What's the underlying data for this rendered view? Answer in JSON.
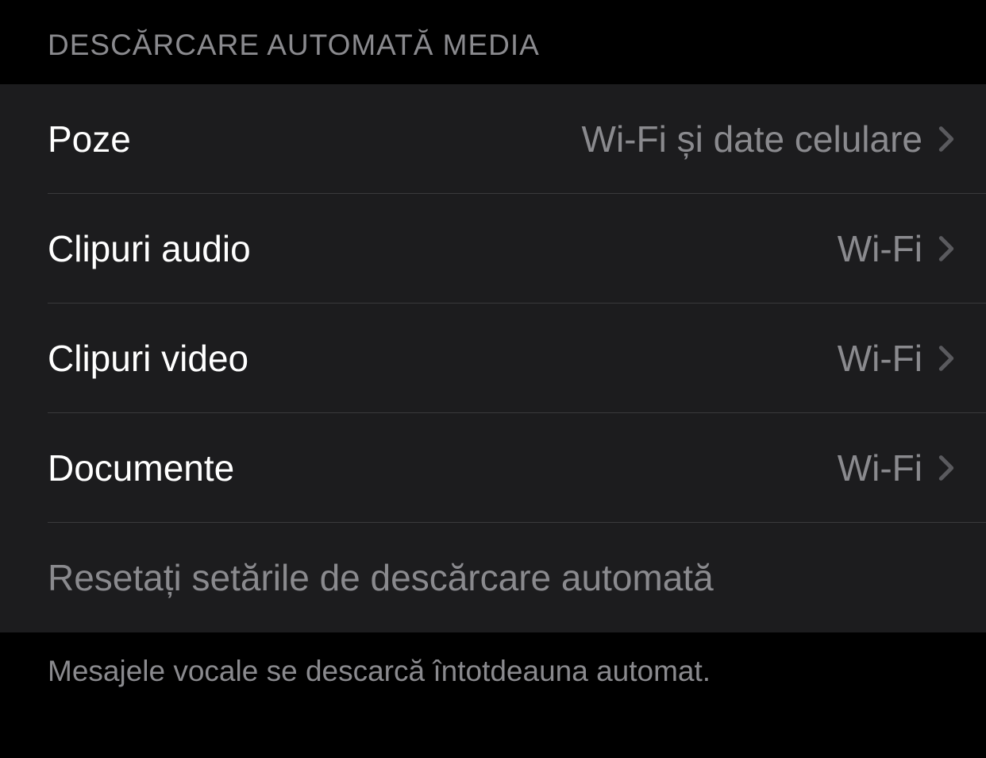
{
  "section": {
    "header": "DESCĂRCARE AUTOMATĂ MEDIA",
    "rows": [
      {
        "label": "Poze",
        "value": "Wi-Fi și date celulare"
      },
      {
        "label": "Clipuri audio",
        "value": "Wi-Fi"
      },
      {
        "label": "Clipuri video",
        "value": "Wi-Fi"
      },
      {
        "label": "Documente",
        "value": "Wi-Fi"
      }
    ],
    "reset_label": "Resetați setările de descărcare automată",
    "footer": "Mesajele vocale se descarcă întotdeauna automat."
  }
}
